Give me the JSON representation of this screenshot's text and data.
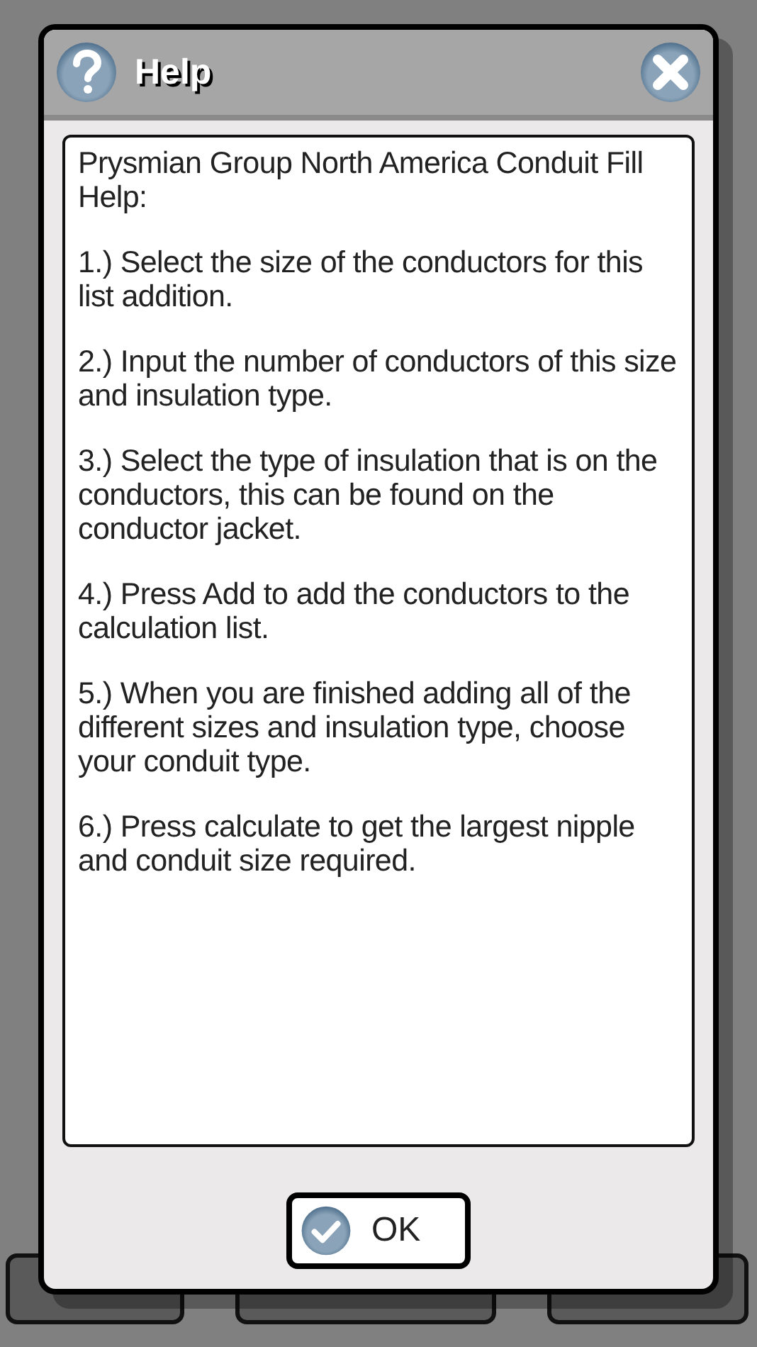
{
  "dialog": {
    "title": "Help",
    "paragraphs": [
      "Prysmian Group North America Conduit Fill Help:",
      "1.) Select the size of the conductors for this list addition.",
      "2.) Input the number of conductors of this size and insulation type.",
      "3.) Select the type of insulation that is on the conductors, this can be found on the conductor jacket.",
      "4.) Press Add to add the conductors to the calculation list.",
      "5.) When you are finished adding all of the different sizes and insulation type, choose your conduit type.",
      "6.) Press calculate to get the largest nipple and conduit size required."
    ],
    "ok_button": "OK"
  }
}
